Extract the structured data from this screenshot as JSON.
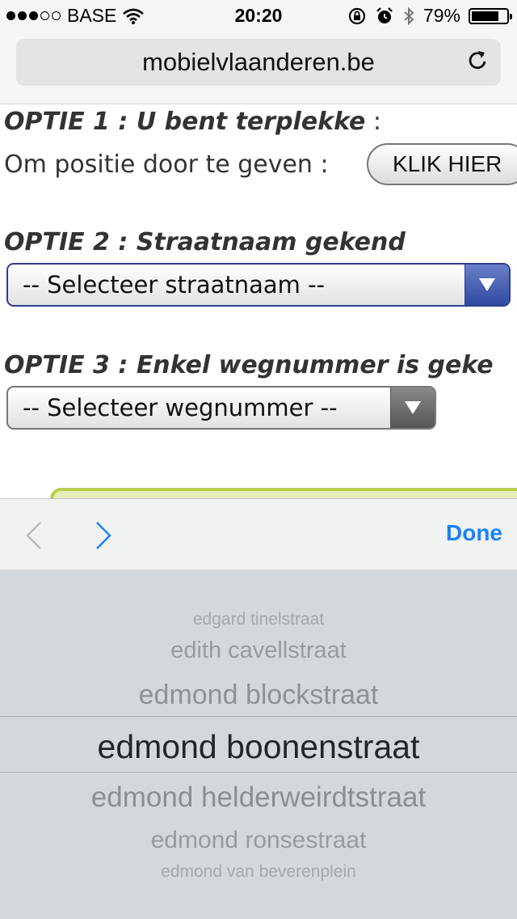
{
  "status_bar": {
    "carrier": "BASE",
    "time": "20:20",
    "battery_percent": "79%",
    "battery_level": 0.79,
    "signal_bars_filled": 3,
    "signal_bars_total": 5,
    "icons": [
      "wifi-icon",
      "rotation-lock-icon",
      "alarm-icon",
      "bluetooth-icon",
      "battery-icon"
    ]
  },
  "browser": {
    "url": "mobielvlaanderen.be",
    "reload_icon": "reload-icon"
  },
  "page": {
    "option1": {
      "title": "OPTIE 1 : U bent terplekke",
      "colon": " :",
      "position_label": "Om positie door te geven :",
      "button_label": "KLIK HIER"
    },
    "option2": {
      "title": "OPTIE 2 : Straatnaam gekend",
      "select_value": "-- Selecteer straatnaam --"
    },
    "option3": {
      "title": "OPTIE 3 : Enkel wegnummer is geke",
      "select_value": "-- Selecteer wegnummer --"
    }
  },
  "toolbar": {
    "prev_icon": "chevron-left-icon",
    "next_icon": "chevron-right-icon",
    "done_label": "Done"
  },
  "picker": {
    "items": [
      "edgard tinelstraat",
      "edith cavellstraat",
      "edmond blockstraat",
      "edmond boonenstraat",
      "edmond helderweirdtstraat",
      "edmond ronsestraat",
      "edmond van beverenplein"
    ],
    "selected": "edmond boonenstraat"
  },
  "colors": {
    "accent_blue": "#1a82fb",
    "select_focus_border": "#2d3f8f",
    "picker_background": "#d3d8dc"
  }
}
